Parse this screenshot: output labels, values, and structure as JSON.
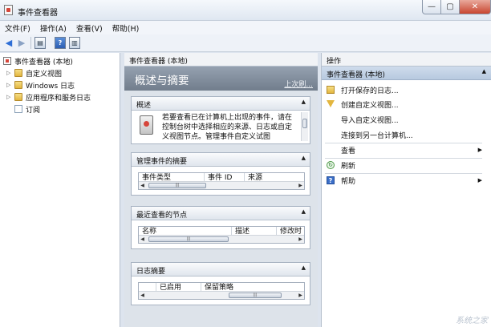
{
  "window": {
    "title": "事件查看器"
  },
  "menu": [
    "文件(F)",
    "操作(A)",
    "查看(V)",
    "帮助(H)"
  ],
  "tree": {
    "root": "事件查看器 (本地)",
    "items": [
      "自定义视图",
      "Windows 日志",
      "应用程序和服务日志",
      "订阅"
    ]
  },
  "center": {
    "header": "事件查看器 (本地)",
    "banner_title": "概述与摘要",
    "banner_link": "上次刷...",
    "overview": {
      "title": "概述",
      "text": "若要查看已在计算机上出现的事件，请在控制台树中选择相应的来源、日志或自定义视图节点。管理事件自定义试图"
    },
    "summary": {
      "title": "管理事件的摘要",
      "columns": [
        "事件类型",
        "事件 ID",
        "来源"
      ]
    },
    "recent": {
      "title": "最近查看的节点",
      "columns": [
        "名称",
        "描述",
        "修改时"
      ]
    },
    "logs": {
      "title": "日志摘要",
      "columns": [
        "",
        "已启用",
        "保留策略"
      ]
    }
  },
  "actions": {
    "header": "操作",
    "group": "事件查看器 (本地)",
    "items": [
      "打开保存的日志...",
      "创建自定义视图...",
      "导入自定义视图...",
      "连接到另一台计算机...",
      "查看",
      "刷新",
      "帮助"
    ]
  },
  "watermark": "系统之家"
}
